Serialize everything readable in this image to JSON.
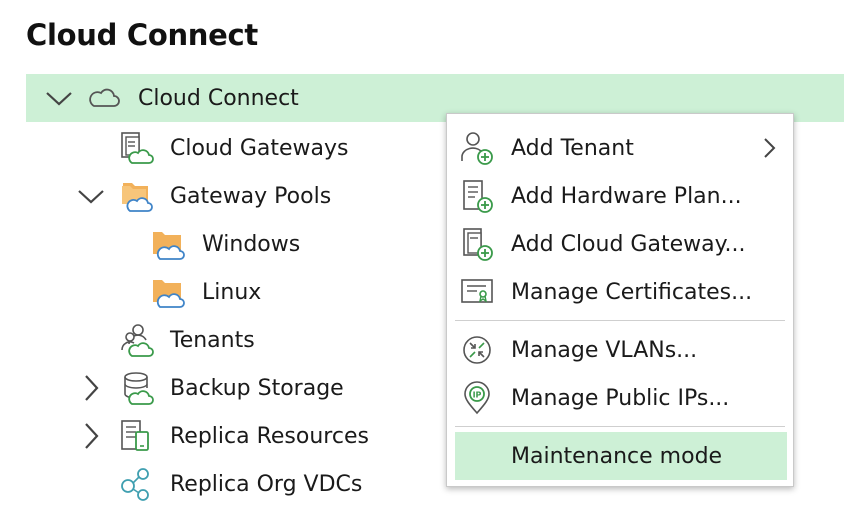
{
  "title": "Cloud Connect",
  "tree": {
    "root": {
      "label": "Cloud Connect",
      "icon": "cloud-icon",
      "expanded": true,
      "selected": true
    },
    "items": [
      {
        "label": "Cloud Gateways",
        "icon": "cloud-gateways-icon"
      },
      {
        "label": "Gateway Pools",
        "icon": "folder-cloud-icon",
        "expanded": true
      },
      {
        "label": "Windows",
        "icon": "folder-cloud-icon"
      },
      {
        "label": "Linux",
        "icon": "folder-cloud-icon"
      },
      {
        "label": "Tenants",
        "icon": "tenants-icon"
      },
      {
        "label": "Backup Storage",
        "icon": "backup-storage-icon",
        "expanded": false
      },
      {
        "label": "Replica Resources",
        "icon": "replica-resources-icon",
        "expanded": false
      },
      {
        "label": "Replica Org VDCs",
        "icon": "org-vdc-icon"
      }
    ]
  },
  "context_menu": {
    "items": [
      {
        "label": "Add Tenant",
        "icon": "add-tenant-icon",
        "submenu": true
      },
      {
        "label": "Add Hardware Plan...",
        "icon": "add-hardware-plan-icon"
      },
      {
        "label": "Add Cloud Gateway...",
        "icon": "add-cloud-gateway-icon"
      },
      {
        "label": "Manage Certificates...",
        "icon": "certificate-icon"
      },
      {
        "label": "Manage VLANs...",
        "icon": "vlan-icon"
      },
      {
        "label": "Manage Public IPs...",
        "icon": "public-ip-icon"
      },
      {
        "label": "Maintenance mode",
        "icon": "",
        "highlighted": true
      }
    ]
  },
  "colors": {
    "selection": "#cdf0d6",
    "icon_green": "#3a9a4a",
    "icon_gray": "#606060",
    "folder": "#f2b15a",
    "cloud_blue": "#3f84c8"
  }
}
